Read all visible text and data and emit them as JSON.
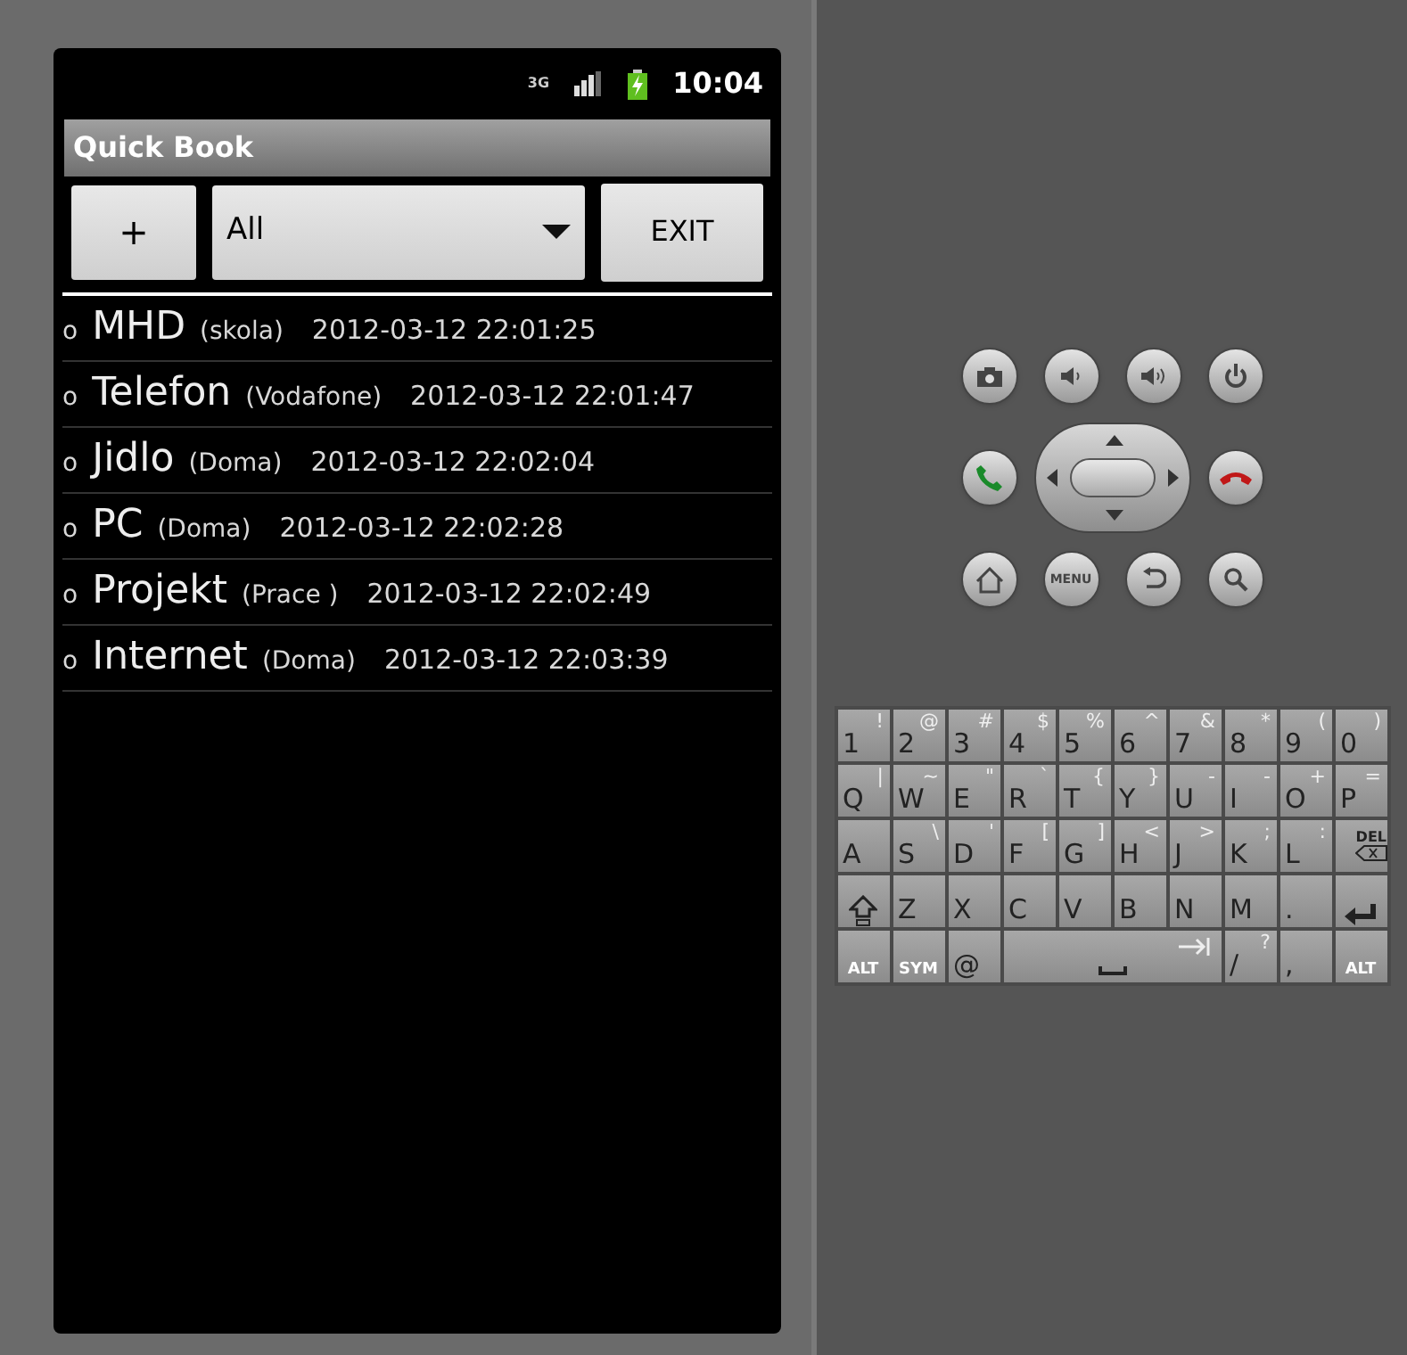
{
  "status_bar": {
    "network": "3G",
    "time": "10:04"
  },
  "title_bar": {
    "title": "Quick Book"
  },
  "toolbar": {
    "add_button": "+",
    "filter": {
      "value": "All"
    },
    "exit_button": "EXIT"
  },
  "entries": [
    {
      "bullet": "o",
      "name": "MHD",
      "place": "(skola)",
      "timestamp": "2012-03-12 22:01:25"
    },
    {
      "bullet": "o",
      "name": "Telefon",
      "place": "(Vodafone)",
      "timestamp": "2012-03-12 22:01:47"
    },
    {
      "bullet": "o",
      "name": "Jidlo",
      "place": "(Doma)",
      "timestamp": "2012-03-12 22:02:04"
    },
    {
      "bullet": "o",
      "name": "PC",
      "place": "(Doma)",
      "timestamp": "2012-03-12 22:02:28"
    },
    {
      "bullet": "o",
      "name": "Projekt",
      "place": "(Prace )",
      "timestamp": "2012-03-12 22:02:49"
    },
    {
      "bullet": "o",
      "name": "Internet",
      "place": "(Doma)",
      "timestamp": "2012-03-12 22:03:39"
    }
  ],
  "hardware_buttons": {
    "menu_label": "MENU"
  },
  "keyboard": {
    "rows": [
      [
        {
          "kind": "char",
          "main": "1",
          "alt": "!"
        },
        {
          "kind": "char",
          "main": "2",
          "alt": "@"
        },
        {
          "kind": "char",
          "main": "3",
          "alt": "#"
        },
        {
          "kind": "char",
          "main": "4",
          "alt": "$"
        },
        {
          "kind": "char",
          "main": "5",
          "alt": "%"
        },
        {
          "kind": "char",
          "main": "6",
          "alt": "^"
        },
        {
          "kind": "char",
          "main": "7",
          "alt": "&"
        },
        {
          "kind": "char",
          "main": "8",
          "alt": "*"
        },
        {
          "kind": "char",
          "main": "9",
          "alt": "("
        },
        {
          "kind": "char",
          "main": "0",
          "alt": ")"
        }
      ],
      [
        {
          "kind": "char",
          "main": "Q",
          "alt": "|"
        },
        {
          "kind": "char",
          "main": "W",
          "alt": "~"
        },
        {
          "kind": "char",
          "main": "E",
          "alt": "\""
        },
        {
          "kind": "char",
          "main": "R",
          "alt": "`"
        },
        {
          "kind": "char",
          "main": "T",
          "alt": "{"
        },
        {
          "kind": "char",
          "main": "Y",
          "alt": "}"
        },
        {
          "kind": "char",
          "main": "U",
          "alt": "-"
        },
        {
          "kind": "char",
          "main": "I",
          "alt": "-"
        },
        {
          "kind": "char",
          "main": "O",
          "alt": "+"
        },
        {
          "kind": "char",
          "main": "P",
          "alt": "="
        }
      ],
      [
        {
          "kind": "char",
          "main": "A"
        },
        {
          "kind": "char",
          "main": "S",
          "alt": "\\"
        },
        {
          "kind": "char",
          "main": "D",
          "alt": "'"
        },
        {
          "kind": "char",
          "main": "F",
          "alt": "["
        },
        {
          "kind": "char",
          "main": "G",
          "alt": "]"
        },
        {
          "kind": "char",
          "main": "H",
          "alt": "<"
        },
        {
          "kind": "char",
          "main": "J",
          "alt": ">"
        },
        {
          "kind": "char",
          "main": "K",
          "alt": ";"
        },
        {
          "kind": "char",
          "main": "L",
          "alt": ":"
        },
        {
          "kind": "delete",
          "main": "DEL"
        }
      ],
      [
        {
          "kind": "shift"
        },
        {
          "kind": "char",
          "main": "Z"
        },
        {
          "kind": "char",
          "main": "X"
        },
        {
          "kind": "char",
          "main": "C"
        },
        {
          "kind": "char",
          "main": "V"
        },
        {
          "kind": "char",
          "main": "B"
        },
        {
          "kind": "char",
          "main": "N"
        },
        {
          "kind": "char",
          "main": "M"
        },
        {
          "kind": "char",
          "main": "."
        },
        {
          "kind": "enter"
        }
      ]
    ],
    "bottom_row": [
      {
        "kind": "label",
        "main": "ALT"
      },
      {
        "kind": "label",
        "main": "SYM"
      },
      {
        "kind": "char",
        "main": "@"
      },
      {
        "kind": "space"
      },
      {
        "kind": "char",
        "main": "/",
        "alt": "?"
      },
      {
        "kind": "char",
        "main": ","
      },
      {
        "kind": "label",
        "main": "ALT"
      }
    ]
  }
}
